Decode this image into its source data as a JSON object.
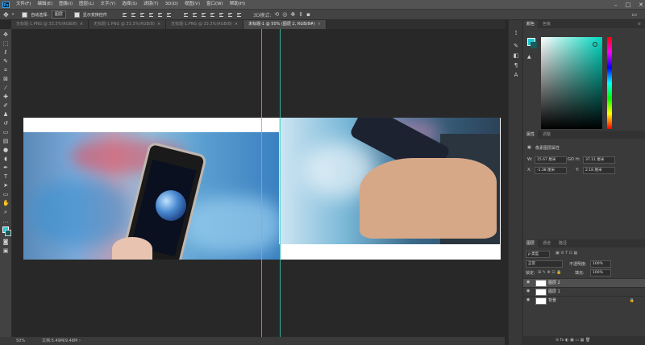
{
  "menubar": {
    "items": [
      "文件(F)",
      "编辑(E)",
      "图像(I)",
      "图层(L)",
      "文字(Y)",
      "选择(S)",
      "滤镜(T)",
      "3D(D)",
      "视图(V)",
      "窗口(W)",
      "帮助(H)"
    ],
    "window_controls": [
      "–",
      "□",
      "✕"
    ]
  },
  "optbar": {
    "auto_select_label": "自动选择:",
    "auto_select_value": "图层",
    "show_transform_label": "显示变换控件"
  },
  "tabs": [
    {
      "label": "无标题-1.PNG @ 33.3%(RGB/8)",
      "active": false
    },
    {
      "label": "无标题-1.PNG @ 33.3%(RGB/8)",
      "active": false
    },
    {
      "label": "无标题-1.PNG @ 33.3%(RGB/8)",
      "active": false
    },
    {
      "label": "未标题-1 @ 50% (图层 2, RGB/8#)",
      "active": true
    }
  ],
  "status": {
    "zoom": "50%",
    "doc": "文档:5.49M/9.48M"
  },
  "panels": {
    "color_tabs": [
      "颜色",
      "色板"
    ],
    "props_tabs": [
      "属性",
      "调整"
    ],
    "props_title": "像素图层属性",
    "w_label": "W:",
    "w_value": "15.67 厘米",
    "h_label": "H:",
    "h_value": "37.11 厘米",
    "x_label": "X:",
    "x_value": "-1.38 厘米",
    "y_label": "Y:",
    "y_value": "2.18 厘米",
    "link_label": "GO",
    "layers_tabs": [
      "图层",
      "通道",
      "路径"
    ],
    "kind": "ρ 类型",
    "blend": "正常",
    "opacity_label": "不透明度:",
    "opacity_value": "100%",
    "lock_label": "锁定:",
    "fill_label": "填充:",
    "fill_value": "100%",
    "layers": [
      {
        "name": "图层 2",
        "selected": true
      },
      {
        "name": "图层 1",
        "selected": false
      },
      {
        "name": "背景",
        "selected": false,
        "locked": true
      }
    ]
  },
  "colors": {
    "foreground": "#1ec8d0",
    "background": "#1a5a5a",
    "guide": "#3fd0c0"
  }
}
